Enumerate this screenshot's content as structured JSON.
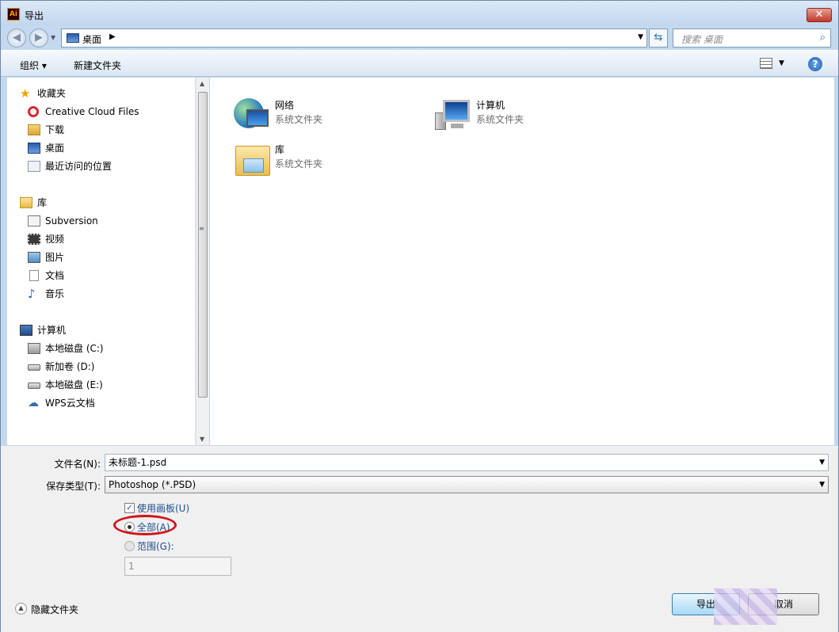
{
  "window": {
    "title": "导出",
    "app_icon_text": "Ai",
    "close_glyph": "✕"
  },
  "nav": {
    "back_glyph": "◀",
    "forward_glyph": "▶",
    "address": "桌面",
    "address_chevron": "▶",
    "search_placeholder": "搜索 桌面"
  },
  "toolbar": {
    "organize": "组织 ▾",
    "new_folder": "新建文件夹",
    "help": "?"
  },
  "sidebar": {
    "favorites": {
      "header": "收藏夹",
      "items": [
        "Creative Cloud Files",
        "下载",
        "桌面",
        "最近访问的位置"
      ]
    },
    "libraries": {
      "header": "库",
      "items": [
        "Subversion",
        "视频",
        "图片",
        "文档",
        "音乐"
      ]
    },
    "computer": {
      "header": "计算机",
      "items": [
        "本地磁盘 (C:)",
        "新加卷 (D:)",
        "本地磁盘 (E:)",
        "WPS云文档"
      ]
    }
  },
  "content": {
    "items": [
      {
        "name": "网络",
        "type": "系统文件夹",
        "icon": "network-icon"
      },
      {
        "name": "计算机",
        "type": "系统文件夹",
        "icon": "computer-icon"
      },
      {
        "name": "库",
        "type": "系统文件夹",
        "icon": "library-folder-icon"
      }
    ]
  },
  "form": {
    "filename_label": "文件名(N):",
    "filename_value": "未标题-1.psd",
    "filetype_label": "保存类型(T):",
    "filetype_value": "Photoshop (*.PSD)",
    "use_artboards": {
      "label": "使用画板(U)",
      "checked": true
    },
    "all_option": {
      "label": "全部(A)",
      "selected": true
    },
    "range_option": {
      "label": "范围(G):",
      "selected": false
    },
    "range_value": "1"
  },
  "footer": {
    "hide_folders": "隐藏文件夹",
    "export_button": "导出",
    "cancel_button": "取消"
  },
  "colors": {
    "highlight_ring": "#d0141c",
    "label_blue": "#1e4e8c"
  }
}
